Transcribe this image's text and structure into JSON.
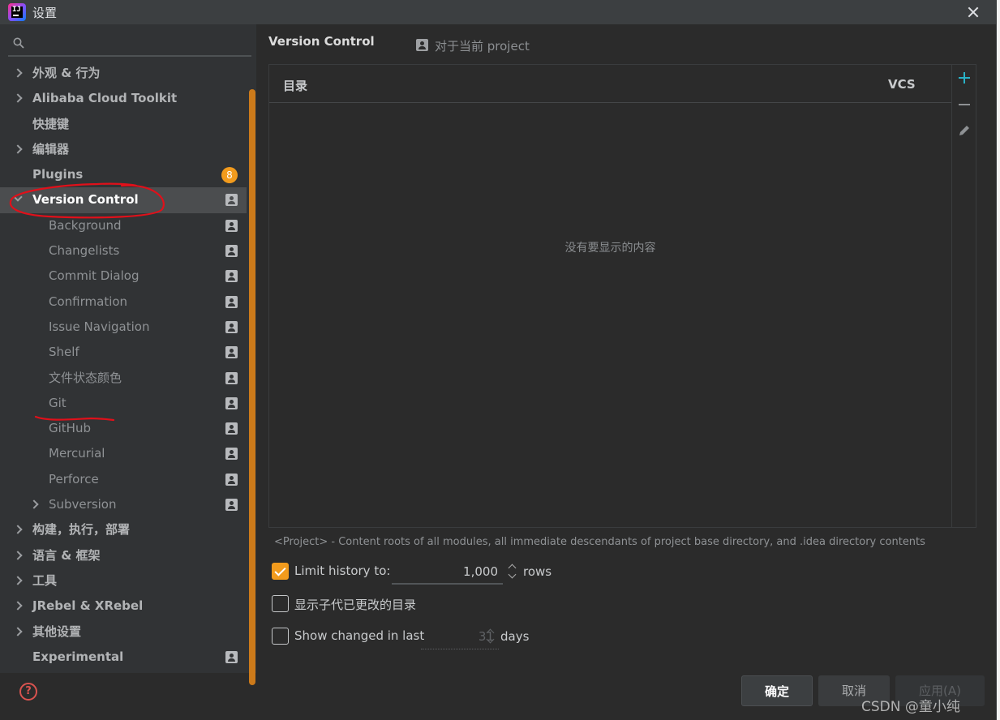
{
  "window": {
    "title": "设置"
  },
  "search": {
    "placeholder": "",
    "value": ""
  },
  "sidebar": {
    "items": [
      {
        "label": "外观 & 行为",
        "level": 0,
        "expandable": true,
        "expanded": false
      },
      {
        "label": "Alibaba Cloud Toolkit",
        "level": 0,
        "expandable": true,
        "expanded": false
      },
      {
        "label": "快捷键",
        "level": 0,
        "expandable": false
      },
      {
        "label": "编辑器",
        "level": 0,
        "expandable": true,
        "expanded": false
      },
      {
        "label": "Plugins",
        "level": 0,
        "expandable": false,
        "badge": "8"
      },
      {
        "label": "Version Control",
        "level": 0,
        "expandable": true,
        "expanded": true,
        "selected": true,
        "project_icon": true
      },
      {
        "label": "Background",
        "level": 1,
        "project_icon": true
      },
      {
        "label": "Changelists",
        "level": 1,
        "project_icon": true
      },
      {
        "label": "Commit Dialog",
        "level": 1,
        "project_icon": true
      },
      {
        "label": "Confirmation",
        "level": 1,
        "project_icon": true
      },
      {
        "label": "Issue Navigation",
        "level": 1,
        "project_icon": true
      },
      {
        "label": "Shelf",
        "level": 1,
        "project_icon": true
      },
      {
        "label": "文件状态颜色",
        "level": 1,
        "project_icon": true
      },
      {
        "label": "Git",
        "level": 1,
        "project_icon": true
      },
      {
        "label": "GitHub",
        "level": 1,
        "project_icon": true
      },
      {
        "label": "Mercurial",
        "level": 1,
        "project_icon": true
      },
      {
        "label": "Perforce",
        "level": 1,
        "project_icon": true
      },
      {
        "label": "Subversion",
        "level": 1,
        "expandable": true,
        "expanded": false,
        "project_icon": true
      },
      {
        "label": "构建，执行，部署",
        "level": 0,
        "expandable": true,
        "expanded": false
      },
      {
        "label": "语言 & 框架",
        "level": 0,
        "expandable": true,
        "expanded": false
      },
      {
        "label": "工具",
        "level": 0,
        "expandable": true,
        "expanded": false
      },
      {
        "label": "JRebel & XRebel",
        "level": 0,
        "expandable": true,
        "expanded": false
      },
      {
        "label": "其他设置",
        "level": 0,
        "expandable": true,
        "expanded": false
      },
      {
        "label": "Experimental",
        "level": 0,
        "expandable": false,
        "project_icon": true
      }
    ]
  },
  "main": {
    "title": "Version Control",
    "scope_label": "对于当前 project",
    "table": {
      "columns": [
        "目录",
        "VCS"
      ],
      "rows": [],
      "empty_text": "没有要显示的内容"
    },
    "hint": "<Project> - Content roots of all modules, all immediate descendants of project base directory, and .idea directory contents",
    "options": {
      "limit_history": {
        "label": "Limit history to:",
        "checked": true,
        "value": "1,000",
        "unit": "rows"
      },
      "show_dirs": {
        "label": "显示子代已更改的目录",
        "checked": false
      },
      "show_changed": {
        "label": "Show changed in last",
        "checked": false,
        "value": "31",
        "unit": "days"
      }
    }
  },
  "buttons": {
    "ok": "确定",
    "cancel": "取消",
    "apply": "应用(A)"
  },
  "help_glyph": "?",
  "watermark": "CSDN @童小纯",
  "colors": {
    "accent": "#f29b1d",
    "selection": "#4b4d4f",
    "add_icon": "#29b2c7",
    "annotation": "#e0101a"
  }
}
